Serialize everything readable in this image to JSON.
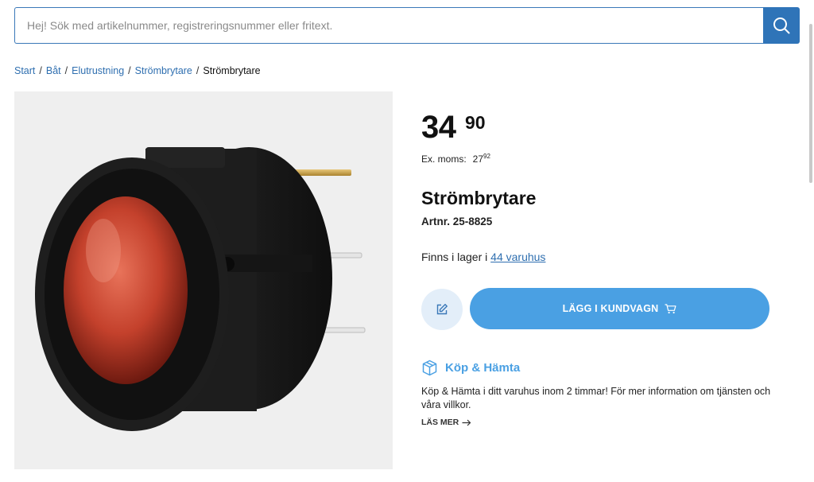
{
  "search": {
    "placeholder": "Hej! Sök med artikelnummer, registreringsnummer eller fritext.",
    "icon": "search-icon"
  },
  "breadcrumb": {
    "items": [
      "Start",
      "Båt",
      "Elutrustning",
      "Strömbrytare"
    ],
    "current": "Strömbrytare",
    "separator": "/"
  },
  "product": {
    "price_main": "34",
    "price_decimals": "90",
    "ex_moms_label": "Ex. moms:",
    "ex_moms_main": "27",
    "ex_moms_decimals": "92",
    "title": "Strömbrytare",
    "artnr": "Artnr. 25-8825",
    "stock_prefix": "Finns i lager i",
    "stock_link": "44 varuhus",
    "image_icon": "rocker-switch-image"
  },
  "actions": {
    "edit_icon": "edit-icon",
    "add_to_cart": "LÄGG I KUNDVAGN",
    "cart_icon": "cart-icon"
  },
  "kop_hamta": {
    "icon": "package-icon",
    "title": "Köp & Hämta",
    "text": "Köp & Hämta i ditt varuhus inom 2 timmar! För mer information om tjänsten och våra villkor.",
    "more": "LÄS MER",
    "more_icon": "arrow-right-icon"
  },
  "colors": {
    "accent": "#2f74b8",
    "button": "#4aa0e3",
    "link": "#2f6fb0"
  }
}
